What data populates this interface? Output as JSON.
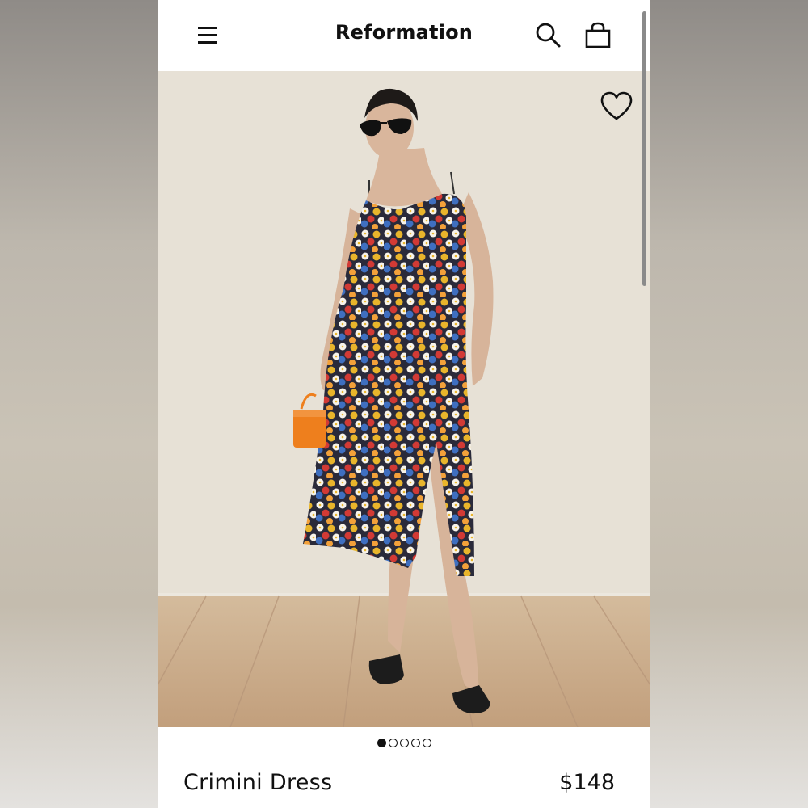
{
  "header": {
    "brand": "Reformation",
    "menu_icon": "hamburger-menu-icon",
    "search_icon": "search-icon",
    "bag_icon": "shopping-bag-icon"
  },
  "product": {
    "name": "Crimini Dress",
    "price": "$148",
    "favorite_icon": "heart-outline-icon"
  },
  "carousel": {
    "total_images": 5,
    "active_index": 0
  },
  "colors": {
    "text": "#111111",
    "background": "#ffffff",
    "wall": "#e6e0d5",
    "floor": "#c9ad8c",
    "bag": "#ee7f1d"
  }
}
